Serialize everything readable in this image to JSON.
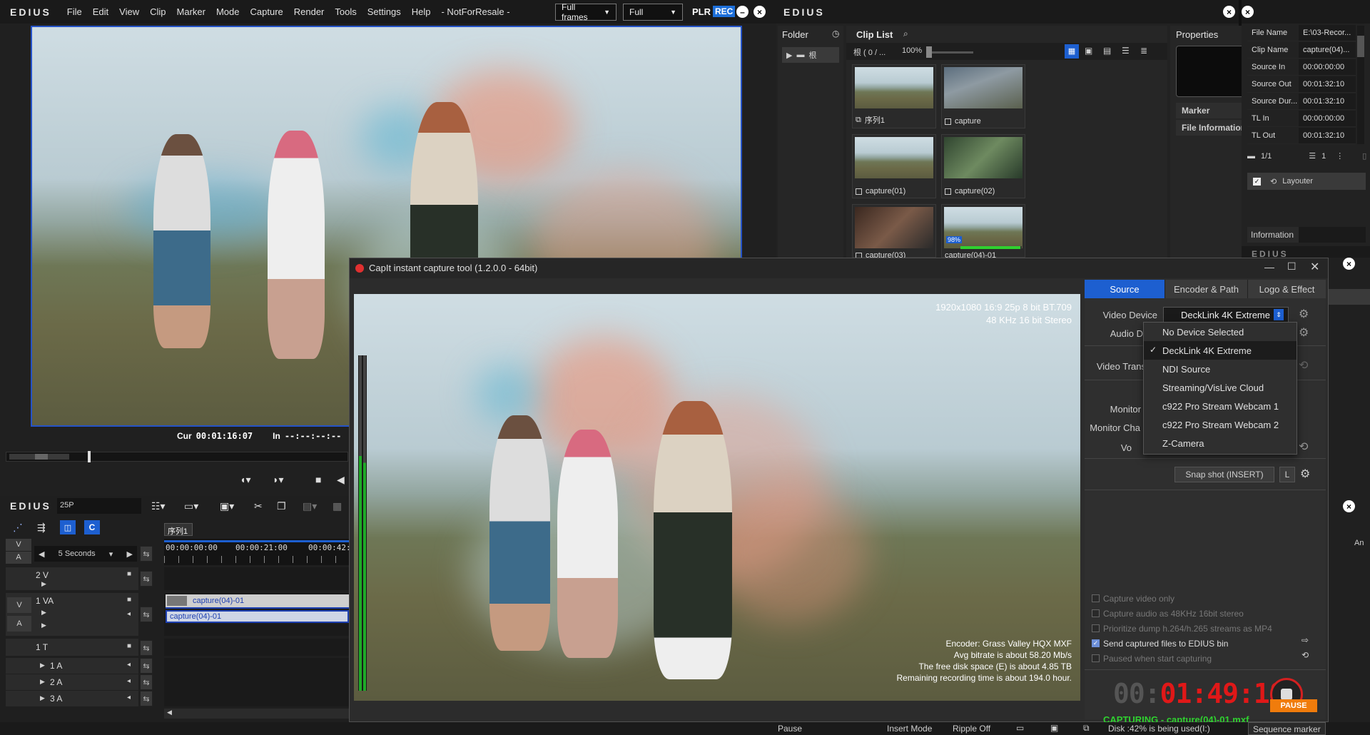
{
  "app": {
    "logo": "EDIUS",
    "menu": [
      "File",
      "Edit",
      "View",
      "Clip",
      "Marker",
      "Mode",
      "Capture",
      "Render",
      "Tools",
      "Settings",
      "Help",
      "- NotForResale -"
    ],
    "frames_select": "Full frames",
    "quality_select": "Full",
    "plr_label": "PLR",
    "rec_label": "REC"
  },
  "player": {
    "cur_label": "Cur",
    "cur_tc": "00:01:16:07",
    "in_label": "In",
    "in_tc": "--:--:--:--",
    "out_label": "Ou"
  },
  "timeline": {
    "logo": "EDIUS",
    "fps": "25P",
    "sequence_tab": "序列1",
    "scale": "5 Seconds",
    "ruler": [
      "00:00:00:00",
      "00:00:21:00",
      "00:00:42:"
    ],
    "v_label": "V",
    "a_label": "A",
    "tracks": [
      {
        "name": "2 V"
      },
      {
        "name": "1 VA",
        "clip_video": "capture(04)-01",
        "clip_audio": "capture(04)-01"
      },
      {
        "name": "1 T"
      },
      {
        "name": "1 A"
      },
      {
        "name": "2 A"
      },
      {
        "name": "3 A"
      }
    ],
    "va_v": "V",
    "va_a": "A"
  },
  "bin": {
    "logo": "EDIUS",
    "folder_title": "Folder",
    "root_folder": "根",
    "cliplist_title": "Clip List",
    "path": "根 ( 0 / ...",
    "zoom": "100%",
    "clips": [
      {
        "name": "序列1"
      },
      {
        "name": "capture"
      },
      {
        "name": "capture(01)"
      },
      {
        "name": "capture(02)"
      },
      {
        "name": "capture(03)"
      },
      {
        "name": "capture(04)-01",
        "progress_label": "98%",
        "progress": 0.98
      }
    ]
  },
  "properties": {
    "title": "Properties",
    "marker_label": "Marker",
    "file_info_label": "File Information",
    "rows": [
      {
        "k": "File Name",
        "v": "E:\\03-Recor..."
      },
      {
        "k": "Clip Name",
        "v": "capture(04)..."
      },
      {
        "k": "Source In",
        "v": "00:00:00:00"
      },
      {
        "k": "Source Out",
        "v": "00:01:32:10"
      },
      {
        "k": "Source Dur...",
        "v": "00:01:32:10"
      },
      {
        "k": "TL In",
        "v": "00:00:00:00"
      },
      {
        "k": "TL Out",
        "v": "00:01:32:10"
      }
    ],
    "page": "1/1",
    "count": "1",
    "layouter": "Layouter",
    "information": "Information",
    "edius_small": "EDIUS",
    "an": "An"
  },
  "capit": {
    "title": "CapIt instant capture tool (1.2.0.0 - 64bit)",
    "format_line1": "1920x1080 16:9 25p 8 bit BT.709",
    "format_line2": "48 KHz  16 bit  Stereo",
    "encoder": "Encoder: Grass Valley HQX MXF",
    "bitrate": "Avg bitrate is about 58.20 Mb/s",
    "disk": "The free disk space (E) is about 4.85 TB",
    "remaining": "Remaining recording time is about 194.0 hour.",
    "tabs": [
      "Source",
      "Encoder & Path",
      "Logo & Effect"
    ],
    "video_device_label": "Video Device",
    "video_device_value": "DeckLink 4K Extreme",
    "audio_label": "Audio D",
    "video_trans_label": "Video Trans",
    "monitor_d_label": "Monitor D",
    "monitor_cha_label": "Monitor Cha",
    "vo_label": "Vo",
    "dropdown": [
      "No Device Selected",
      "DeckLink 4K Extreme",
      "NDI Source",
      "Streaming/VisLive Cloud",
      "c922 Pro Stream Webcam 1",
      "c922 Pro Stream Webcam 2",
      "Z-Camera"
    ],
    "dropdown_selected_check": "✓",
    "snapshot": "Snap shot (INSERT)",
    "l_btn": "L",
    "options": [
      {
        "label": "Capture video only",
        "checked": false
      },
      {
        "label": "Capture audio as 48KHz 16bit stereo",
        "checked": false
      },
      {
        "label": "Prioritize dump h.264/h.265 streams as MP4",
        "checked": false
      },
      {
        "label": "Send captured files to EDIUS bin",
        "checked": true
      },
      {
        "label": "Paused when start capturing",
        "checked": false
      }
    ],
    "timecode_dim": "00:",
    "timecode": "01:49:18",
    "status": "CAPTURING - capture(04)-01.mxf",
    "pause_btn": "PAUSE"
  },
  "statusbar": {
    "pause": "Pause",
    "insert_mode": "Insert Mode",
    "ripple": "Ripple Off",
    "disk": "Disk :42% is being used(I:)",
    "seq_marker": "Sequence marker"
  }
}
